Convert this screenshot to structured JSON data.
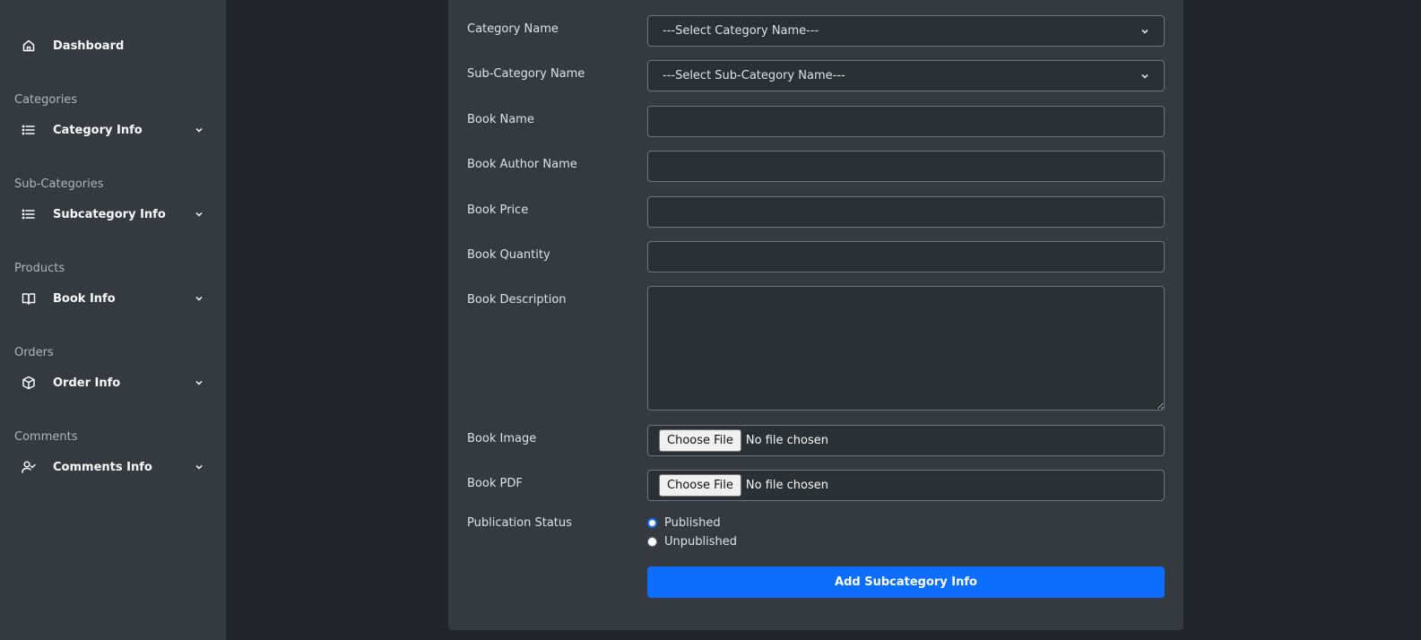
{
  "sidebar": {
    "dashboard": {
      "label": "Dashboard",
      "icon": "home-icon"
    },
    "sections": [
      {
        "heading": "Categories",
        "label": "Category Info",
        "icon": "list-icon"
      },
      {
        "heading": "Sub-Categories",
        "label": "Subcategory Info",
        "icon": "list-icon"
      },
      {
        "heading": "Products",
        "label": "Book Info",
        "icon": "book-open-icon"
      },
      {
        "heading": "Orders",
        "label": "Order Info",
        "icon": "box-icon"
      },
      {
        "heading": "Comments",
        "label": "Comments Info",
        "icon": "user-check-icon"
      }
    ]
  },
  "form": {
    "category": {
      "label": "Category Name",
      "value": "---Select Category Name---"
    },
    "subcategory": {
      "label": "Sub-Category Name",
      "value": "---Select Sub-Category Name---"
    },
    "book_name": {
      "label": "Book Name",
      "value": "",
      "placeholder": ""
    },
    "author": {
      "label": "Book Author Name",
      "value": "",
      "placeholder": ""
    },
    "price": {
      "label": "Book Price",
      "value": "",
      "placeholder": ""
    },
    "quantity": {
      "label": "Book Quantity",
      "value": "",
      "placeholder": ""
    },
    "description": {
      "label": "Book Description",
      "value": ""
    },
    "image": {
      "label": "Book Image",
      "button": "Choose File",
      "status": "No file chosen"
    },
    "pdf": {
      "label": "Book PDF",
      "button": "Choose File",
      "status": "No file chosen"
    },
    "status": {
      "label": "Publication Status",
      "options": [
        {
          "label": "Published",
          "checked": true
        },
        {
          "label": "Unpublished",
          "checked": false
        }
      ]
    },
    "submit": "Add Subcategory Info"
  },
  "colors": {
    "background": "#212529",
    "panel": "#343a40",
    "accent": "#0d6efd"
  }
}
